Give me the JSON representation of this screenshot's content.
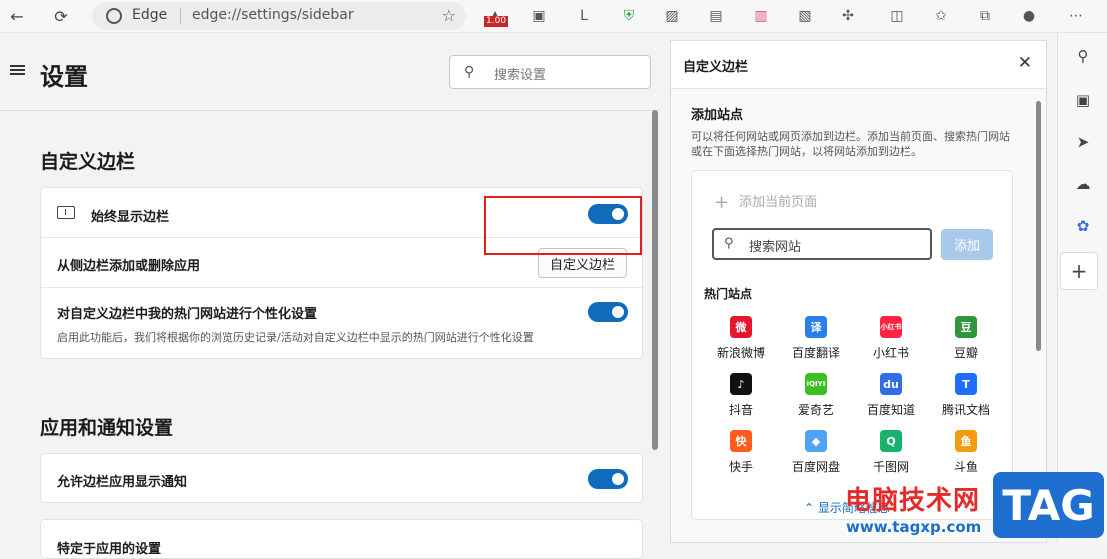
{
  "browser": {
    "brand": "Edge",
    "url": "edge://settings/sidebar",
    "badge": "1.00"
  },
  "settings": {
    "title": "设置",
    "search_placeholder": "搜索设置",
    "section1_title": "自定义边栏",
    "rows": [
      {
        "label": "始终显示边栏"
      },
      {
        "label": "从侧边栏添加或删除应用",
        "button": "自定义边栏"
      },
      {
        "label": "对自定义边栏中我的热门网站进行个性化设置",
        "desc": "启用此功能后，我们将根据你的浏览历史记录/活动对自定义边栏中显示的热门网站进行个性化设置"
      }
    ],
    "section2_title": "应用和通知设置",
    "notify_row": "允许边栏应用显示通知",
    "partial_row": "特定于应用的设置"
  },
  "panel": {
    "title": "自定义边栏",
    "add_title": "添加站点",
    "add_desc": "可以将任何网站或网页添加到边栏。添加当前页面、搜索热门网站或在下面选择热门网站，以将网站添加到边栏。",
    "add_current": "添加当前页面",
    "search_placeholder": "搜索网站",
    "add_button": "添加",
    "hot_label": "热门站点",
    "sites": [
      {
        "name": "新浪微博",
        "icon": "weibo-icon",
        "glyph": "微",
        "color": "#e6162d"
      },
      {
        "name": "百度翻译",
        "icon": "baidu-translate-icon",
        "glyph": "译",
        "color": "#2b7fe8"
      },
      {
        "name": "小红书",
        "icon": "xiaohongshu-icon",
        "glyph": "小红书",
        "color": "#ff2442"
      },
      {
        "name": "豆瓣",
        "icon": "douban-icon",
        "glyph": "豆",
        "color": "#2e963d"
      },
      {
        "name": "抖音",
        "icon": "douyin-icon",
        "glyph": "♪",
        "color": "#111111"
      },
      {
        "name": "爱奇艺",
        "icon": "iqiyi-icon",
        "glyph": "iQIYI",
        "color": "#3cbf23"
      },
      {
        "name": "百度知道",
        "icon": "baidu-zhidao-icon",
        "glyph": "du",
        "color": "#2f6ee5"
      },
      {
        "name": "腾讯文档",
        "icon": "tencent-docs-icon",
        "glyph": "T",
        "color": "#1e6fff"
      },
      {
        "name": "快手",
        "icon": "kuaishou-icon",
        "glyph": "快",
        "color": "#ff5b1a"
      },
      {
        "name": "百度网盘",
        "icon": "baidu-netdisk-icon",
        "glyph": "◆",
        "color": "#4fa3f7"
      },
      {
        "name": "千图网",
        "icon": "qiantu-icon",
        "glyph": "Q",
        "color": "#16b36b"
      },
      {
        "name": "斗鱼",
        "icon": "douyu-icon",
        "glyph": "鱼",
        "color": "#f39c12"
      }
    ],
    "show_less": "显示简略信息"
  },
  "watermark": {
    "cn": "电脑技术网",
    "url": "www.tagxp.com",
    "tag": "TAG"
  },
  "colors": {
    "accent": "#0f6cbd",
    "highlight": "#e01e1e"
  }
}
